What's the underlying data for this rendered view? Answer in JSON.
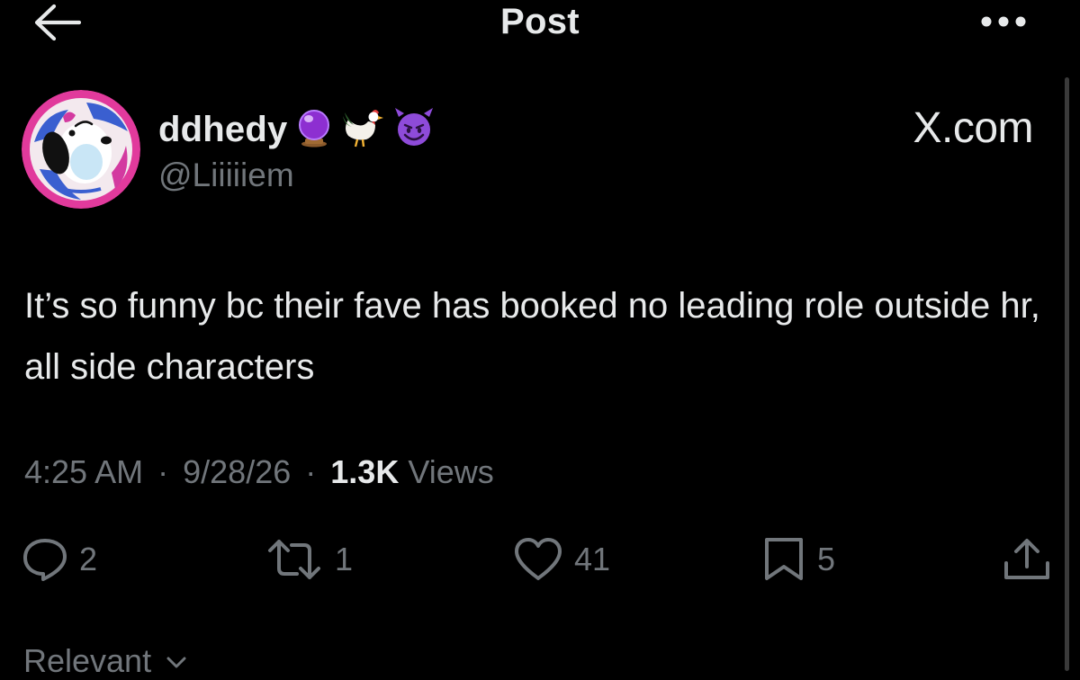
{
  "header": {
    "title": "Post",
    "back_icon": "arrow-left-icon",
    "more_icon": "more-dots-icon"
  },
  "author": {
    "display_name": "ddhedy",
    "emojis": [
      "crystal-ball-emoji",
      "rooster-emoji",
      "smiling-devil-emoji"
    ],
    "handle": "@Liiiiiem",
    "avatar": "snoopy-avatar"
  },
  "source_label": "X.com",
  "post": {
    "text": "It’s so funny bc their fave has booked no leading role outside hr, all side characters"
  },
  "meta": {
    "time": "4:25 AM",
    "separator": "·",
    "date": "9/28/26",
    "views_count": "1.3K",
    "views_label": "Views"
  },
  "actions": {
    "replies": "2",
    "reposts": "1",
    "likes": "41",
    "bookmarks": "5"
  },
  "sort": {
    "label": "Relevant"
  },
  "colors": {
    "background": "#000000",
    "text_primary": "#e7e9ea",
    "text_secondary": "#71767b",
    "avatar_ring": "#e13a9c"
  }
}
